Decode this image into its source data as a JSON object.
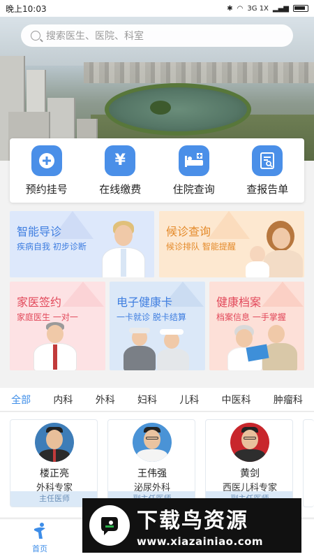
{
  "status_bar": {
    "time": "晚上10:03",
    "network": "3G 1X"
  },
  "search": {
    "placeholder": "搜索医生、医院、科室"
  },
  "quick_actions": [
    {
      "label": "预约挂号",
      "icon": "plus-circle-icon"
    },
    {
      "label": "在线缴费",
      "icon": "yen-icon"
    },
    {
      "label": "住院查询",
      "icon": "hospital-bed-icon"
    },
    {
      "label": "查报告单",
      "icon": "report-search-icon"
    }
  ],
  "cards": {
    "smart_guide": {
      "title": "智能导诊",
      "subtitle": "疾病自我 初步诊断"
    },
    "queue_query": {
      "title": "候诊查询",
      "subtitle": "候诊排队 智能提醒"
    },
    "family_doctor": {
      "title": "家医签约",
      "subtitle": "家庭医生  一对一"
    },
    "health_card": {
      "title": "电子健康卡",
      "subtitle": "一卡就诊 脱卡结算"
    },
    "health_record": {
      "title": "健康档案",
      "subtitle": "档案信息 一手掌握"
    }
  },
  "dept_tabs": [
    "全部",
    "内科",
    "外科",
    "妇科",
    "儿科",
    "中医科",
    "肿瘤科"
  ],
  "active_tab": "全部",
  "doctors": [
    {
      "name": "楼正亮",
      "dept": "外科专家",
      "title": "主任医师"
    },
    {
      "name": "王伟强",
      "dept": "泌尿外科",
      "title": "副主任医师"
    },
    {
      "name": "黄剑",
      "dept": "西医儿科专家",
      "title": "副主任医师"
    }
  ],
  "bottom_nav": {
    "home_label": "首页"
  },
  "watermark": {
    "title": "下载鸟资源",
    "url": "www.xiazainiao.com"
  },
  "colors": {
    "accent": "#3d8de8",
    "quick_icon_bg": "#4a8fe8"
  }
}
